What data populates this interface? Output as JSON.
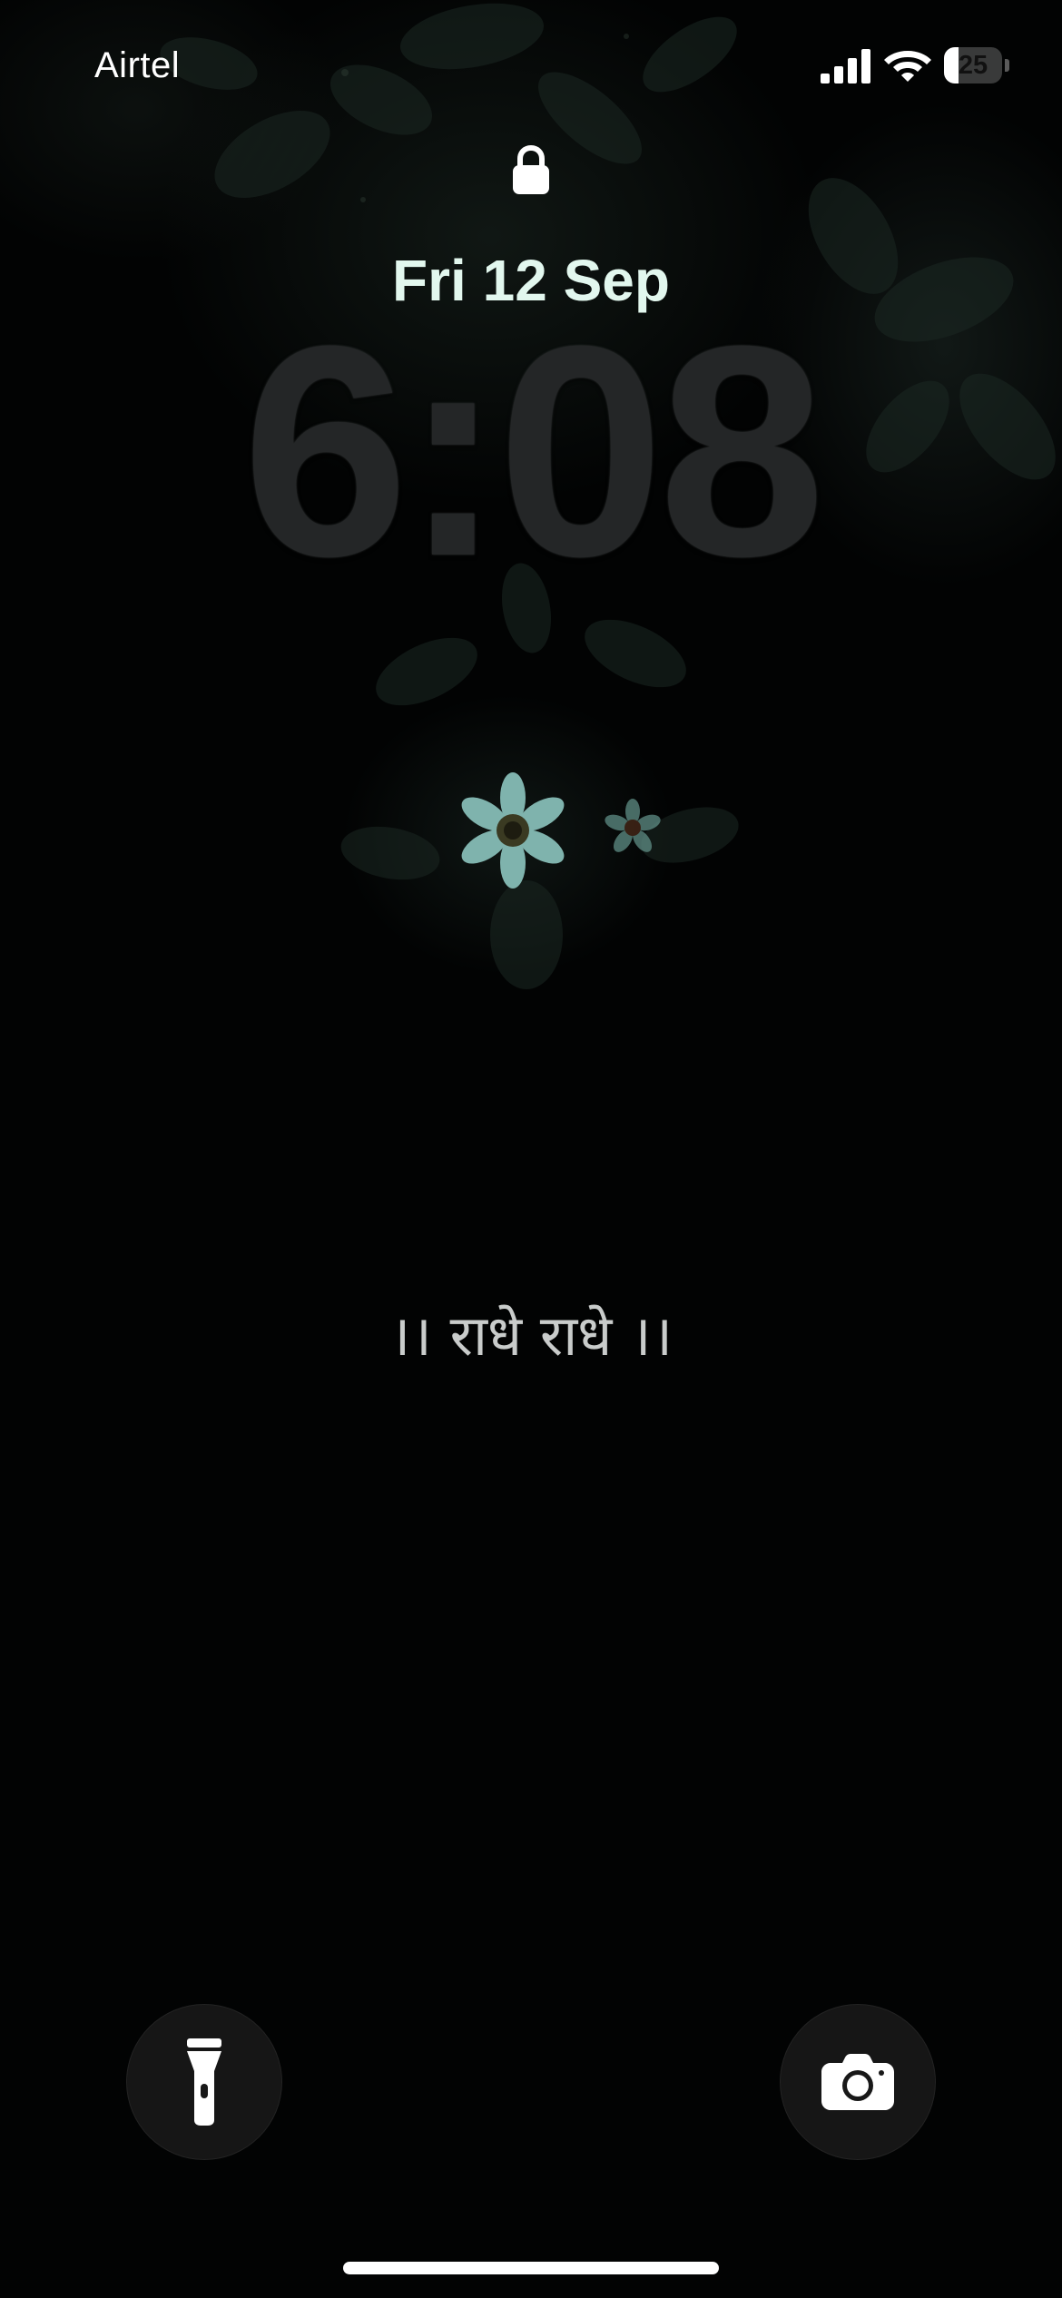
{
  "status_bar": {
    "carrier": "Airtel",
    "signal_icon": "cellular-signal-icon",
    "wifi_icon": "wifi-icon",
    "battery_icon": "battery-icon",
    "battery_level": "25",
    "battery_fraction": 0.25
  },
  "lock_screen": {
    "lock_icon": "lock-icon",
    "date": "Fri 12 Sep",
    "time": "6:08",
    "widget_icon": "flower-icon",
    "quote": "।। राधे राधे ।।"
  },
  "quick_actions": {
    "flashlight_icon": "flashlight-icon",
    "camera_icon": "camera-icon"
  },
  "colors": {
    "background": "#000000",
    "date_text": "#e2f7ee",
    "time_text": "#242627",
    "quote_text": "#c9cccb",
    "button_bg": "#181818",
    "flower_petal": "#7fb3ad"
  }
}
